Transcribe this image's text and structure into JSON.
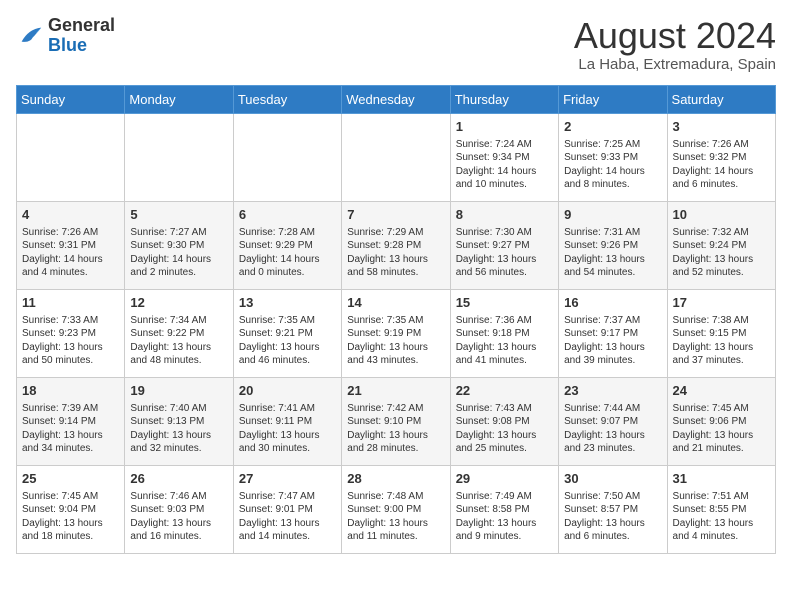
{
  "header": {
    "logo_general": "General",
    "logo_blue": "Blue",
    "month_year": "August 2024",
    "location": "La Haba, Extremadura, Spain"
  },
  "weekdays": [
    "Sunday",
    "Monday",
    "Tuesday",
    "Wednesday",
    "Thursday",
    "Friday",
    "Saturday"
  ],
  "weeks": [
    [
      {
        "day": "",
        "info": ""
      },
      {
        "day": "",
        "info": ""
      },
      {
        "day": "",
        "info": ""
      },
      {
        "day": "",
        "info": ""
      },
      {
        "day": "1",
        "info": "Sunrise: 7:24 AM\nSunset: 9:34 PM\nDaylight: 14 hours\nand 10 minutes."
      },
      {
        "day": "2",
        "info": "Sunrise: 7:25 AM\nSunset: 9:33 PM\nDaylight: 14 hours\nand 8 minutes."
      },
      {
        "day": "3",
        "info": "Sunrise: 7:26 AM\nSunset: 9:32 PM\nDaylight: 14 hours\nand 6 minutes."
      }
    ],
    [
      {
        "day": "4",
        "info": "Sunrise: 7:26 AM\nSunset: 9:31 PM\nDaylight: 14 hours\nand 4 minutes."
      },
      {
        "day": "5",
        "info": "Sunrise: 7:27 AM\nSunset: 9:30 PM\nDaylight: 14 hours\nand 2 minutes."
      },
      {
        "day": "6",
        "info": "Sunrise: 7:28 AM\nSunset: 9:29 PM\nDaylight: 14 hours\nand 0 minutes."
      },
      {
        "day": "7",
        "info": "Sunrise: 7:29 AM\nSunset: 9:28 PM\nDaylight: 13 hours\nand 58 minutes."
      },
      {
        "day": "8",
        "info": "Sunrise: 7:30 AM\nSunset: 9:27 PM\nDaylight: 13 hours\nand 56 minutes."
      },
      {
        "day": "9",
        "info": "Sunrise: 7:31 AM\nSunset: 9:26 PM\nDaylight: 13 hours\nand 54 minutes."
      },
      {
        "day": "10",
        "info": "Sunrise: 7:32 AM\nSunset: 9:24 PM\nDaylight: 13 hours\nand 52 minutes."
      }
    ],
    [
      {
        "day": "11",
        "info": "Sunrise: 7:33 AM\nSunset: 9:23 PM\nDaylight: 13 hours\nand 50 minutes."
      },
      {
        "day": "12",
        "info": "Sunrise: 7:34 AM\nSunset: 9:22 PM\nDaylight: 13 hours\nand 48 minutes."
      },
      {
        "day": "13",
        "info": "Sunrise: 7:35 AM\nSunset: 9:21 PM\nDaylight: 13 hours\nand 46 minutes."
      },
      {
        "day": "14",
        "info": "Sunrise: 7:35 AM\nSunset: 9:19 PM\nDaylight: 13 hours\nand 43 minutes."
      },
      {
        "day": "15",
        "info": "Sunrise: 7:36 AM\nSunset: 9:18 PM\nDaylight: 13 hours\nand 41 minutes."
      },
      {
        "day": "16",
        "info": "Sunrise: 7:37 AM\nSunset: 9:17 PM\nDaylight: 13 hours\nand 39 minutes."
      },
      {
        "day": "17",
        "info": "Sunrise: 7:38 AM\nSunset: 9:15 PM\nDaylight: 13 hours\nand 37 minutes."
      }
    ],
    [
      {
        "day": "18",
        "info": "Sunrise: 7:39 AM\nSunset: 9:14 PM\nDaylight: 13 hours\nand 34 minutes."
      },
      {
        "day": "19",
        "info": "Sunrise: 7:40 AM\nSunset: 9:13 PM\nDaylight: 13 hours\nand 32 minutes."
      },
      {
        "day": "20",
        "info": "Sunrise: 7:41 AM\nSunset: 9:11 PM\nDaylight: 13 hours\nand 30 minutes."
      },
      {
        "day": "21",
        "info": "Sunrise: 7:42 AM\nSunset: 9:10 PM\nDaylight: 13 hours\nand 28 minutes."
      },
      {
        "day": "22",
        "info": "Sunrise: 7:43 AM\nSunset: 9:08 PM\nDaylight: 13 hours\nand 25 minutes."
      },
      {
        "day": "23",
        "info": "Sunrise: 7:44 AM\nSunset: 9:07 PM\nDaylight: 13 hours\nand 23 minutes."
      },
      {
        "day": "24",
        "info": "Sunrise: 7:45 AM\nSunset: 9:06 PM\nDaylight: 13 hours\nand 21 minutes."
      }
    ],
    [
      {
        "day": "25",
        "info": "Sunrise: 7:45 AM\nSunset: 9:04 PM\nDaylight: 13 hours\nand 18 minutes."
      },
      {
        "day": "26",
        "info": "Sunrise: 7:46 AM\nSunset: 9:03 PM\nDaylight: 13 hours\nand 16 minutes."
      },
      {
        "day": "27",
        "info": "Sunrise: 7:47 AM\nSunset: 9:01 PM\nDaylight: 13 hours\nand 14 minutes."
      },
      {
        "day": "28",
        "info": "Sunrise: 7:48 AM\nSunset: 9:00 PM\nDaylight: 13 hours\nand 11 minutes."
      },
      {
        "day": "29",
        "info": "Sunrise: 7:49 AM\nSunset: 8:58 PM\nDaylight: 13 hours\nand 9 minutes."
      },
      {
        "day": "30",
        "info": "Sunrise: 7:50 AM\nSunset: 8:57 PM\nDaylight: 13 hours\nand 6 minutes."
      },
      {
        "day": "31",
        "info": "Sunrise: 7:51 AM\nSunset: 8:55 PM\nDaylight: 13 hours\nand 4 minutes."
      }
    ]
  ]
}
